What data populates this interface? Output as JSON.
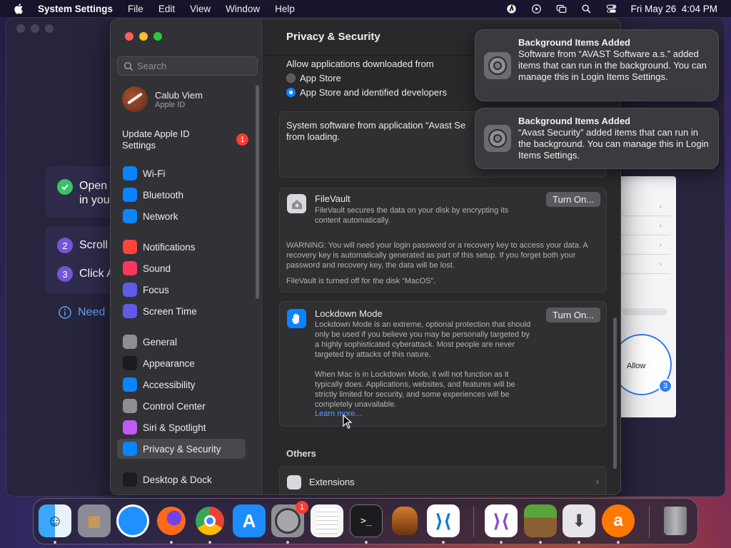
{
  "menubar": {
    "app_name": "System Settings",
    "menus": [
      "File",
      "Edit",
      "View",
      "Window",
      "Help"
    ],
    "clock": "Fri May 26  4:04 PM"
  },
  "background_window": {
    "step1": "Open\nin you",
    "step2": "Scroll",
    "step3": "Click A",
    "step2_num": "2",
    "step3_num": "3",
    "need_help": "Need",
    "allow_label": "Allow",
    "allow_step": "3"
  },
  "sidebar": {
    "search_placeholder": "Search",
    "apple_id_name": "Calub Viem",
    "apple_id_sub": "Apple ID",
    "update_label": "Update Apple ID\nSettings",
    "update_badge": "1",
    "items": [
      {
        "label": "Wi-Fi",
        "icon": "wifi-icon",
        "color": "#0a84ff"
      },
      {
        "label": "Bluetooth",
        "icon": "bluetooth-icon",
        "color": "#0a84ff"
      },
      {
        "label": "Network",
        "icon": "globe-icon",
        "color": "#0a84ff"
      },
      {
        "label": "Notifications",
        "icon": "bell-icon",
        "color": "#ff453a"
      },
      {
        "label": "Sound",
        "icon": "speaker-icon",
        "color": "#ff375f"
      },
      {
        "label": "Focus",
        "icon": "moon-icon",
        "color": "#5e5ce6"
      },
      {
        "label": "Screen Time",
        "icon": "hourglass-icon",
        "color": "#5e5ce6"
      },
      {
        "label": "General",
        "icon": "gear-icon",
        "color": "#8e8e93"
      },
      {
        "label": "Appearance",
        "icon": "appearance-icon",
        "color": "#1c1c1e"
      },
      {
        "label": "Accessibility",
        "icon": "accessibility-icon",
        "color": "#0a84ff"
      },
      {
        "label": "Control Center",
        "icon": "control-center-icon",
        "color": "#8e8e93"
      },
      {
        "label": "Siri & Spotlight",
        "icon": "siri-icon",
        "color": "#bf5af2"
      },
      {
        "label": "Privacy & Security",
        "icon": "hand-icon",
        "color": "#0a84ff"
      },
      {
        "label": "Desktop & Dock",
        "icon": "dock-icon",
        "color": "#1c1c1e"
      }
    ]
  },
  "main": {
    "title": "Privacy & Security",
    "allow_from_label": "Allow applications downloaded from",
    "radio_app_store": "App Store",
    "radio_identified": "App Store and identified developers",
    "blocked_text": "System software from application “Avast Se\nfrom loading.",
    "filevault": {
      "title": "FileVault",
      "desc": "FileVault secures the data on your disk by encrypting its content automatically.",
      "warning": "WARNING: You will need your login password or a recovery key to access your data. A recovery key is automatically generated as part of this setup. If you forget both your password and recovery key, the data will be lost.",
      "status": "FileVault is turned off for the disk “MacOS”.",
      "button": "Turn On..."
    },
    "lockdown": {
      "title": "Lockdown Mode",
      "desc": "Lockdown Mode is an extreme, optional protection that should only be used if you believe you may be personally targeted by a highly sophisticated cyberattack. Most people are never targeted by attacks of this nature.",
      "desc2": "When Mac is in Lockdown Mode, it will not function as it typically does. Applications, websites, and features will be strictly limited for security, and some experiences will be completely unavailable.",
      "link": "Learn more...",
      "button": "Turn On..."
    },
    "others_heading": "Others",
    "extensions_label": "Extensions"
  },
  "notifications": [
    {
      "title": "Background Items Added",
      "body": "Software from “AVAST Software a.s.” added items that can run in the background. You can manage this in Login Items Settings."
    },
    {
      "title": "Background Items Added",
      "body": "“Avast Security” added items that can run in the background. You can manage this in Login Items Settings."
    }
  ],
  "dock": {
    "apps": [
      "Finder",
      "Launchpad",
      "Safari",
      "Firefox",
      "Chrome",
      "App Store",
      "System Settings",
      "TextEdit",
      "Terminal",
      "GarageBand",
      "Visual Studio Code",
      "Visual Studio",
      "Minecraft",
      "Installer",
      "Avast",
      "Trash"
    ],
    "settings_badge": "1"
  },
  "colors": {
    "accent": "#0a84ff",
    "badge": "#ff3b30"
  }
}
